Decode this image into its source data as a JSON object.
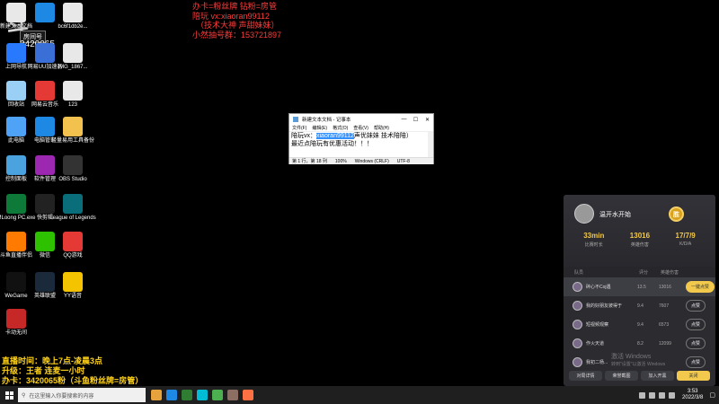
{
  "desktop_icons": [
    {
      "label": "新建文本文档",
      "icon": "text-file-icon",
      "color": "#e8e8e8"
    },
    {
      "label": "",
      "icon": "edge-browser-icon",
      "color": "#1e88e5"
    },
    {
      "label": "bc6f1db2e...",
      "icon": "image-file-icon",
      "color": "#e8e8e8"
    },
    {
      "label": "上网导航",
      "icon": "navigation-icon",
      "color": "#2979ff"
    },
    {
      "label": "网易UU加速器",
      "icon": "uu-accelerator-icon",
      "color": "#3b6fd8"
    },
    {
      "label": "IMG_1867...",
      "icon": "image-file-icon",
      "color": "#e8e8e8"
    },
    {
      "label": "回收站",
      "icon": "recycle-bin-icon",
      "color": "#9ad0f5"
    },
    {
      "label": "网易云音乐",
      "icon": "netease-music-icon",
      "color": "#e53935"
    },
    {
      "label": "123",
      "icon": "image-file-icon",
      "color": "#e8e8e8"
    },
    {
      "label": "此电脑",
      "icon": "this-pc-icon",
      "color": "#4fa3f7"
    },
    {
      "label": "电脑管家",
      "icon": "pc-manager-icon",
      "color": "#1e88e5"
    },
    {
      "label": "轻量易用工具备份",
      "icon": "folder-icon",
      "color": "#f2c14e"
    },
    {
      "label": "控制面板",
      "icon": "control-panel-icon",
      "color": "#4aa3df"
    },
    {
      "label": "软件管理",
      "icon": "software-manager-icon",
      "color": "#9c27b0"
    },
    {
      "label": "OBS Studio",
      "icon": "obs-icon",
      "color": "#333333"
    },
    {
      "label": "MLoong PC.exe",
      "icon": "game-exe-icon",
      "color": "#0d7a3a"
    },
    {
      "label": "快剪辑",
      "icon": "video-editor-icon",
      "color": "#222222"
    },
    {
      "label": "League of Legends",
      "icon": "league-of-legends-icon",
      "color": "#0a6e7a"
    },
    {
      "label": "斗鱼直播伴侣",
      "icon": "douyu-icon",
      "color": "#ff7a00"
    },
    {
      "label": "微信",
      "icon": "wechat-icon",
      "color": "#2dc100"
    },
    {
      "label": "QQ游戏",
      "icon": "qq-game-icon",
      "color": "#e53935"
    },
    {
      "label": "WeGame",
      "icon": "wegame-icon",
      "color": "#111111"
    },
    {
      "label": "英雄联盟",
      "icon": "lol-client-icon",
      "color": "#1a2a3a"
    },
    {
      "label": "YY语音",
      "icon": "yy-voice-icon",
      "color": "#f5c400"
    },
    {
      "label": "卡动无间",
      "icon": "game-icon",
      "color": "#c62828"
    }
  ],
  "logo_overlay": {
    "big": "斗",
    "tag": "房间号",
    "room": "3420065"
  },
  "red_overlay": [
    "办卡=粉丝牌 钻粉=房管",
    "陪玩 vx:xiaoran99112",
    "（技术大神 声甜妹妹）",
    "小然抽号群：153721897"
  ],
  "notepad": {
    "title": "新建文本文档 - 记事本",
    "menu": [
      "文件(F)",
      "编辑(E)",
      "格式(O)",
      "查看(V)",
      "帮助(H)"
    ],
    "line1_prefix": "陪玩vx：",
    "line1_selected": "xiaoran99112",
    "line1_suffix": "声优妹妹 技术陪陪）",
    "line2": "最近点陪玩有优惠活动！！！",
    "status": [
      "第 1 行，第 18 列",
      "100%",
      "Windows (CRLF)",
      "UTF-8"
    ]
  },
  "panel": {
    "player_name": "温开水开始",
    "badge": "胜",
    "stats": [
      {
        "value": "33min",
        "label": "比赛时长"
      },
      {
        "value": "13016",
        "label": "英雄伤害"
      },
      {
        "value": "17/7/9",
        "label": "K/D/A"
      }
    ],
    "headers": [
      "队员",
      "评分",
      "英雄伤害"
    ],
    "rows": [
      {
        "name": "碎心不Coj遇",
        "score": "13.5",
        "damage": "13016",
        "button": "一键点赞"
      },
      {
        "name": "我的好朋友彼得于",
        "score": "9.4",
        "damage": "7607",
        "button": "点赞"
      },
      {
        "name": "短视频观察",
        "score": "9.4",
        "damage": "6573",
        "button": "点赞"
      },
      {
        "name": "作火天道",
        "score": "8.2",
        "damage": "12099",
        "button": "点赞"
      },
      {
        "name": "我初二杨...",
        "score": "",
        "damage": "",
        "button": "点赞"
      }
    ],
    "footer": [
      "对局详情",
      "荣誉截图",
      "加入开黑",
      "关闭"
    ],
    "watermark_line1": "激活 Windows",
    "watermark_line2": "转到\"设置\"以激活 Windows"
  },
  "yellow_overlay": [
    "直播时间：晚上7点-凌晨3点",
    "升级：王者 连麦一小时",
    "办卡：3420065粉（斗鱼粉丝牌=房管）"
  ],
  "taskbar": {
    "search_placeholder": "在这里输入你要搜索的内容",
    "apps": [
      "#e6a23c",
      "#1e88e5",
      "#2e7d32",
      "#00bcd4",
      "#4caf50",
      "#8d6e63",
      "#ff7043"
    ],
    "time": "3:53",
    "date": "2022/3/8"
  }
}
